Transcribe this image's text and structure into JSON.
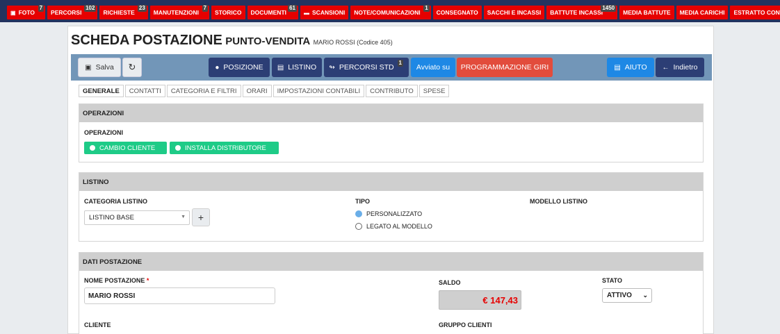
{
  "topnav": [
    {
      "label": "FOTO",
      "count": "7",
      "icon": "camera-icon"
    },
    {
      "label": "PERCORSI",
      "count": "102"
    },
    {
      "label": "RICHIESTE",
      "count": "23"
    },
    {
      "label": "MANUTENZIONI",
      "count": "7"
    },
    {
      "label": "STORICO"
    },
    {
      "label": "DOCUMENTI",
      "count": "61"
    },
    {
      "label": "SCANSIONI",
      "icon": "folder-icon"
    },
    {
      "label": "NOTE/COMUNICAZIONI",
      "count": "1"
    },
    {
      "label": "CONSEGNATO"
    },
    {
      "label": "SACCHI E INCASSI"
    },
    {
      "label": "BATTUTE INCASSI",
      "count": "1450"
    },
    {
      "label": "MEDIA BATTUTE"
    },
    {
      "label": "MEDIA CARICHI"
    },
    {
      "label": "ESTRATTO CONTO"
    }
  ],
  "header": {
    "title": "SCHEDA POSTAZIONE",
    "subtitle": "PUNTO-VENDITA",
    "detail": "MARIO ROSSI (Codice 405)"
  },
  "toolbar": {
    "save": "Salva",
    "posizione": "POSIZIONE",
    "listino": "LISTINO",
    "percorsi_std": "PERCORSI STD",
    "percorsi_std_count": "1",
    "avviato_su": "Avviato su",
    "programmazione": "PROGRAMMAZIONE GIRI",
    "aiuto": "AIUTO",
    "indietro": "Indietro"
  },
  "tabs": [
    "GENERALE",
    "CONTATTI",
    "CATEGORIA E FILTRI",
    "ORARI",
    "IMPOSTAZIONI CONTABILI",
    "CONTRIBUTO",
    "SPESE"
  ],
  "operazioni": {
    "header": "OPERAZIONI",
    "label": "OPERAZIONI",
    "btn_cambio": "CAMBIO CLIENTE",
    "btn_installa": "INSTALLA DISTRIBUTORE"
  },
  "listino": {
    "header": "LISTINO",
    "categoria_label": "CATEGORIA LISTINO",
    "categoria_value": "LISTINO BASE",
    "tipo_label": "TIPO",
    "tipo_personalizzato": "PERSONALIZZATO",
    "tipo_legato": "LEGATO AL MODELLO",
    "tipo_selected": "PERSONALIZZATO",
    "modello_label": "MODELLO LISTINO",
    "plus": "+"
  },
  "dati": {
    "header": "DATI POSTAZIONE",
    "nome_label": "NOME POSTAZIONE",
    "nome_required": "*",
    "nome_value": "MARIO ROSSI",
    "saldo_label": "SALDO",
    "saldo_value": "€ 147,43",
    "stato_label": "STATO",
    "stato_value": "ATTIVO",
    "cliente_label": "CLIENTE",
    "gruppo_label": "GRUPPO CLIENTI"
  },
  "colors": {
    "nav_bg": "#23335f",
    "chip_red": "#e60000",
    "toolbar_bg": "#7296b8",
    "green": "#1ecb87",
    "accent_blue": "#1e88e5"
  }
}
